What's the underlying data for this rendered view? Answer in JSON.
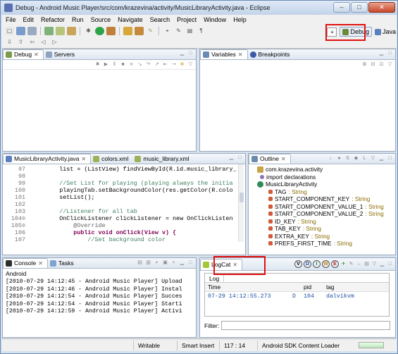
{
  "window": {
    "title": "Debug - Android Music Player/src/com/krazevina/activity/MusicLibraryActivity.java - Eclipse",
    "minimize": "–",
    "maximize": "□",
    "close": "✕"
  },
  "menu": [
    "File",
    "Edit",
    "Refactor",
    "Run",
    "Source",
    "Navigate",
    "Search",
    "Project",
    "Window",
    "Help"
  ],
  "perspectives": {
    "debug": "Debug",
    "java": "Java"
  },
  "debug_panel": {
    "tabs": [
      "Debug",
      "Servers"
    ]
  },
  "variables_panel": {
    "tabs": [
      "Variables",
      "Breakpoints"
    ]
  },
  "editor": {
    "tabs": [
      "MusicLibraryActivity.java",
      "colors.xml",
      "music_library.xml"
    ],
    "lines": [
      {
        "num": "97",
        "text": "        list = (ListView) findViewById(R.id.music_library_"
      },
      {
        "num": "98",
        "text": ""
      },
      {
        "num": "99",
        "text": "        //Set List for playing (playing always the initia"
      },
      {
        "num": "100",
        "text": "        playingTab.setBackgroundColor(res.getColor(R.colo"
      },
      {
        "num": "101",
        "text": "        setList();"
      },
      {
        "num": "102",
        "text": ""
      },
      {
        "num": "103",
        "text": "        //Listener for all tab"
      },
      {
        "num": "104⊙",
        "text": "        OnClickListener clickListener = new OnClickListen"
      },
      {
        "num": "105⊙",
        "text": "            @Override"
      },
      {
        "num": "106",
        "text": "            public void onClick(View v) {"
      },
      {
        "num": "107",
        "text": "                //Set background color"
      }
    ]
  },
  "outline": {
    "tab": "Outline",
    "items": [
      {
        "label": "com.krazevina.activity",
        "type": ""
      },
      {
        "label": "import declarations",
        "type": ""
      },
      {
        "label": "MusicLibraryActivity",
        "type": ""
      },
      {
        "label": "TAG",
        "type": ": String"
      },
      {
        "label": "START_COMPONENT_KEY",
        "type": ": String"
      },
      {
        "label": "START_COMPONENT_VALUE_1",
        "type": ": String"
      },
      {
        "label": "START_COMPONENT_VALUE_2",
        "type": ": String"
      },
      {
        "label": "ID_KEY",
        "type": ": String"
      },
      {
        "label": "TAB_KEY",
        "type": ": String"
      },
      {
        "label": "EXTRA_KEY",
        "type": ": String"
      },
      {
        "label": "PREFS_FIRST_TIME",
        "type": ": String"
      }
    ]
  },
  "console": {
    "tabs": [
      "Console",
      "Tasks"
    ],
    "header": "Android",
    "lines": [
      "[2010-07-29 14:12:45 - Android Music Player] Upload",
      "[2010-07-29 14:12:46 - Android Music Player] Instal",
      "[2010-07-29 14:12:54 - Android Music Player] Succes",
      "[2010-07-29 14:12:54 - Android Music Player] Starti",
      "[2010-07-29 14:12:59 - Android Music Player] Activi"
    ]
  },
  "logcat": {
    "tab": "LogCat",
    "level_buttons": [
      "V",
      "D",
      "I",
      "W",
      "E"
    ],
    "subtab": "Log",
    "columns": [
      "Time",
      "pid",
      "tag"
    ],
    "rows": [
      {
        "time": "07-29 14:12:55.273",
        "level": "D",
        "pid": "104",
        "tag": "dalvikvm"
      }
    ],
    "filter_label": "Filter:",
    "filter_value": ""
  },
  "status": {
    "mode": "Writable",
    "insert": "Smart Insert",
    "position": "117 : 14",
    "loader": "Android SDK Content Loader"
  },
  "colors": {
    "highlight": "#e01010",
    "accent": "#3d6dbf"
  }
}
